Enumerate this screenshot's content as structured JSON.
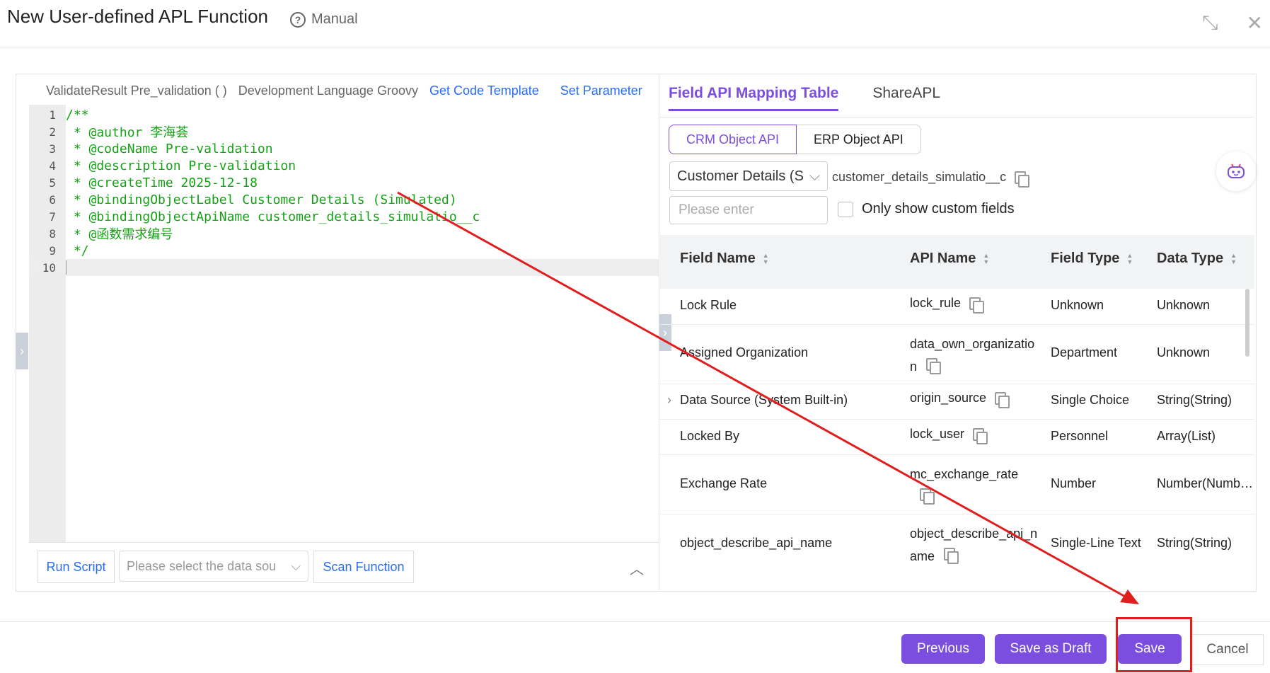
{
  "header": {
    "title": "New User-defined APL Function",
    "manual_label": "Manual",
    "icons": [
      "help-icon",
      "minimize-icon",
      "close-icon"
    ]
  },
  "editor": {
    "function_signature": "ValidateResult Pre_validation ( )",
    "language_label": "Development Language Groovy",
    "get_template_label": "Get Code Template",
    "set_parameter_label": "Set Parameter",
    "lines": [
      {
        "num": "1",
        "text": "/**"
      },
      {
        "num": "2",
        "text": " * @author 李海荟"
      },
      {
        "num": "3",
        "text": " * @codeName Pre-validation"
      },
      {
        "num": "4",
        "text": " * @description Pre-validation"
      },
      {
        "num": "5",
        "text": " * @createTime 2025-12-18"
      },
      {
        "num": "6",
        "text": " * @bindingObjectLabel Customer Details (Simulated)"
      },
      {
        "num": "7",
        "text": " * @bindingObjectApiName customer_details_simulatio__c"
      },
      {
        "num": "8",
        "text": " * @函数需求编号"
      },
      {
        "num": "9",
        "text": " */"
      },
      {
        "num": "10",
        "text": ""
      }
    ],
    "run_script_label": "Run Script",
    "data_source_placeholder": "Please select the data sou",
    "scan_function_label": "Scan Function"
  },
  "right_panel": {
    "tabs": [
      "Field API Mapping Table",
      "ShareAPL"
    ],
    "segments": [
      "CRM Object API",
      "ERP Object API"
    ],
    "object_select_value": "Customer Details (S",
    "object_api_name": "customer_details_simulatio__c",
    "search_placeholder": "Please enter",
    "custom_fields_label": "Only show custom fields",
    "columns": [
      "Field Name",
      "API Name",
      "Field Type",
      "Data Type"
    ],
    "rows": [
      {
        "field_name": "Lock Rule",
        "api_name_1": "lock_rule",
        "api_name_2": "",
        "field_type": "Unknown",
        "data_type": "Unknown"
      },
      {
        "field_name": "Assigned Organization",
        "api_name_1": "data_own_organizatio",
        "api_name_2": "n",
        "field_type": "Department",
        "data_type": "Unknown"
      },
      {
        "field_name": "Data Source (System Built-in)",
        "api_name_1": "origin_source",
        "api_name_2": "",
        "field_type": "Single Choice",
        "data_type": "String(String)"
      },
      {
        "field_name": "Locked By",
        "api_name_1": "lock_user",
        "api_name_2": "",
        "field_type": "Personnel",
        "data_type": "Array(List)"
      },
      {
        "field_name": "Exchange Rate",
        "api_name_1": "mc_exchange_rate",
        "api_name_2": "",
        "field_type": "Number",
        "data_type": "Number(Numb…"
      },
      {
        "field_name": "object_describe_api_name",
        "api_name_1": "object_describe_api_n",
        "api_name_2": "ame",
        "field_type": "Single-Line Text",
        "data_type": "String(String)"
      }
    ]
  },
  "footer": {
    "previous_label": "Previous",
    "save_draft_label": "Save as Draft",
    "save_label": "Save",
    "cancel_label": "Cancel"
  },
  "colors": {
    "accent": "#7b4ee0",
    "link": "#2b6cf0",
    "code": "#14a314",
    "annotation": "#e01e1e"
  }
}
